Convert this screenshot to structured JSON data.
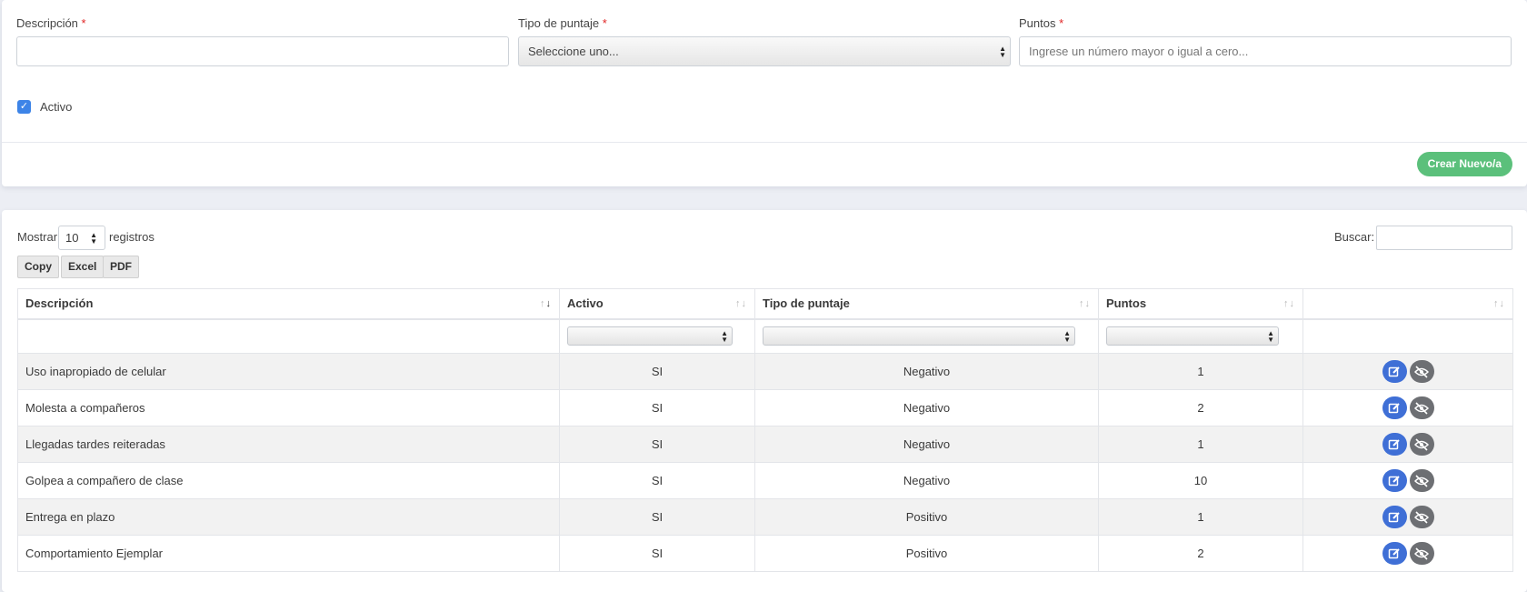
{
  "form": {
    "descripcion_label": "Descripción",
    "descripcion_value": "",
    "tipo_label": "Tipo de puntaje",
    "tipo_selected": "Seleccione uno...",
    "puntos_label": "Puntos",
    "puntos_placeholder": "Ingrese un número mayor o igual a cero...",
    "required_mark": "*",
    "activo_label": "Activo",
    "activo_checked": true,
    "create_button": "Crear Nuevo/a"
  },
  "table_controls": {
    "show_label": "Mostrar",
    "show_value": "10",
    "records_label": "registros",
    "search_label": "Buscar:",
    "search_value": "",
    "buttons": [
      "Copy",
      "Excel",
      "PDF"
    ]
  },
  "table": {
    "columns": [
      "Descripción",
      "Activo",
      "Tipo de puntaje",
      "Puntos",
      ""
    ],
    "sorted_column": "Descripción",
    "sort_direction": "desc",
    "rows": [
      {
        "descripcion": "Uso inapropiado de celular",
        "activo": "SI",
        "tipo": "Negativo",
        "puntos": "1"
      },
      {
        "descripcion": "Molesta a compañeros",
        "activo": "SI",
        "tipo": "Negativo",
        "puntos": "2"
      },
      {
        "descripcion": "Llegadas tardes reiteradas",
        "activo": "SI",
        "tipo": "Negativo",
        "puntos": "1"
      },
      {
        "descripcion": "Golpea a compañero de clase",
        "activo": "SI",
        "tipo": "Negativo",
        "puntos": "10"
      },
      {
        "descripcion": "Entrega en plazo",
        "activo": "SI",
        "tipo": "Positivo",
        "puntos": "1"
      },
      {
        "descripcion": "Comportamiento Ejemplar",
        "activo": "SI",
        "tipo": "Positivo",
        "puntos": "2"
      }
    ],
    "row_actions": [
      "edit-icon",
      "eye-slash-icon"
    ]
  },
  "colors": {
    "accent_blue": "#3f6fd6",
    "checkbox_blue": "#3d84e7",
    "create_green": "#5bc07b",
    "hide_gray": "#6d6f73",
    "required_red": "#e02424"
  }
}
